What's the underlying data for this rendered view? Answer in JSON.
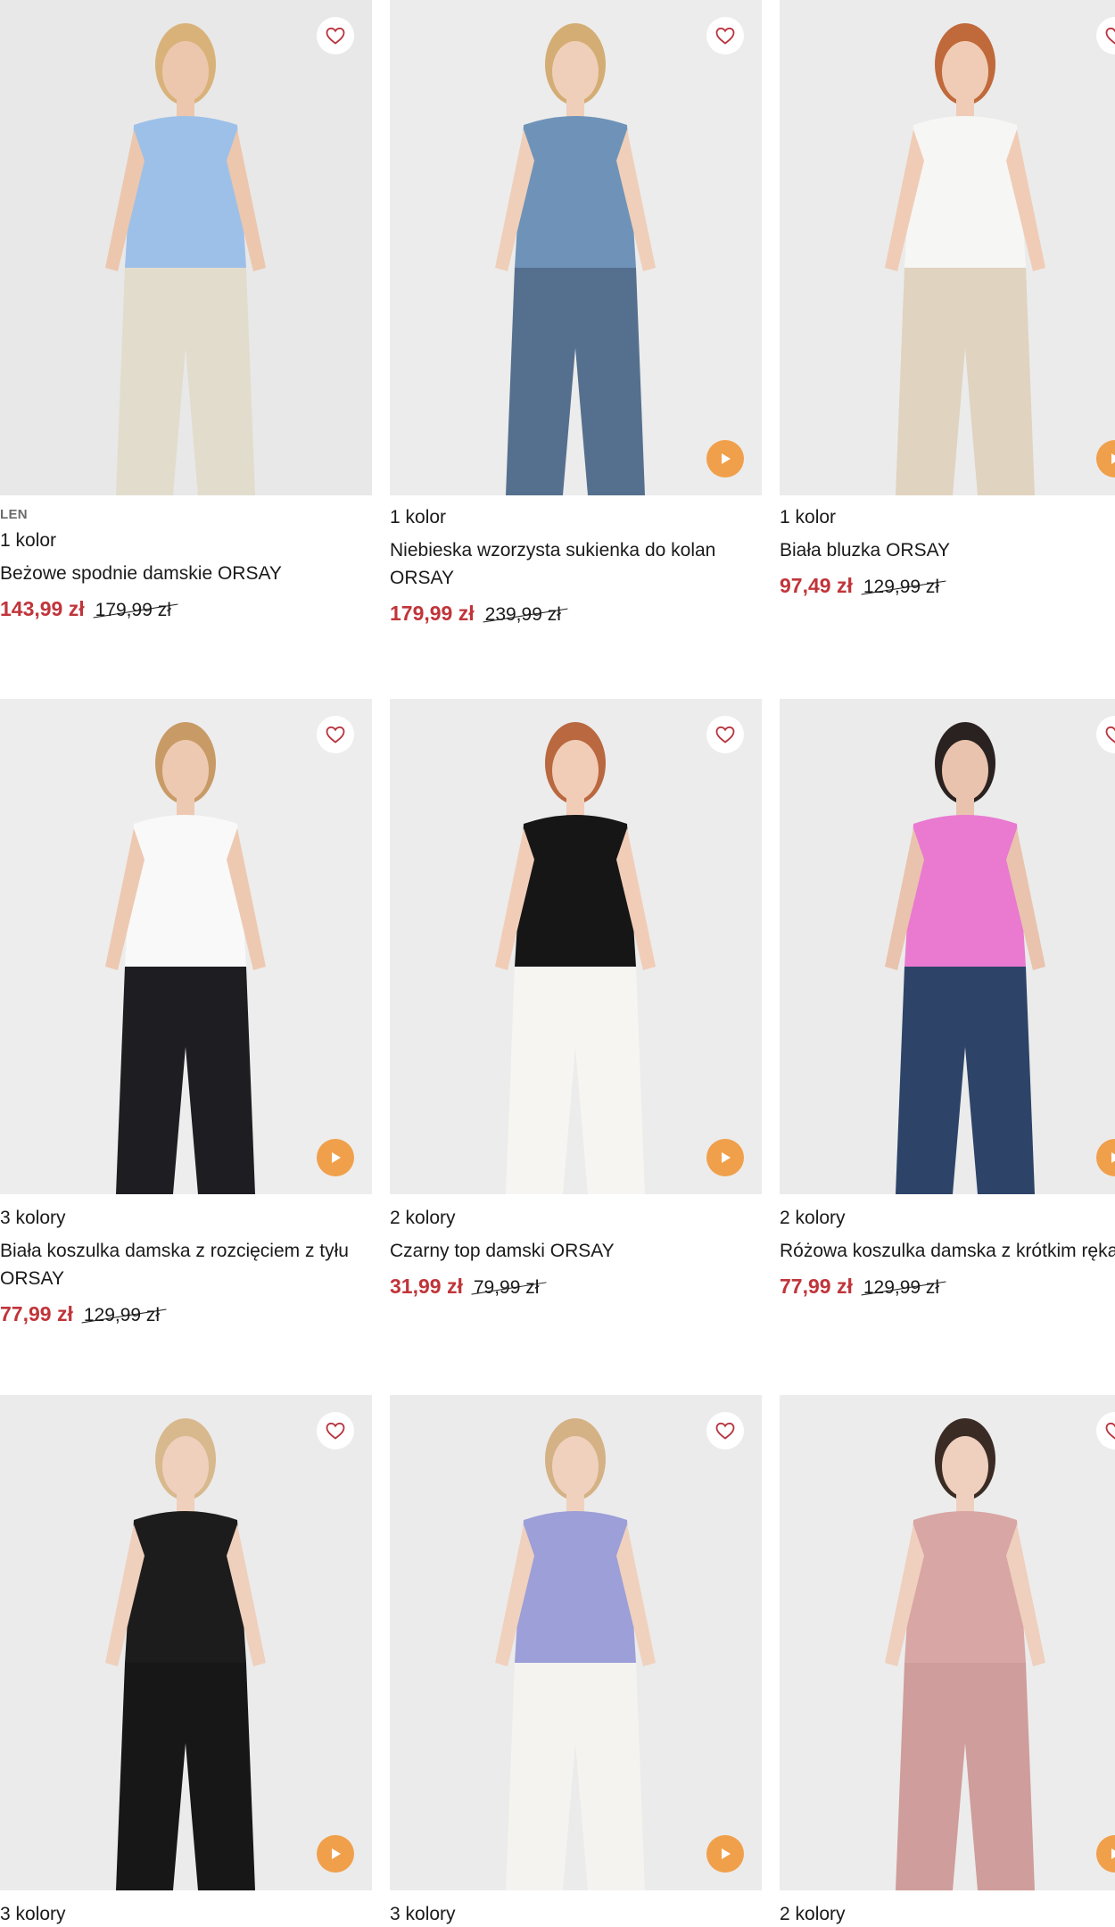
{
  "products": [
    {
      "tag": "LEN",
      "colors": "1 kolor",
      "name": "Beżowe spodnie damskie ORSAY",
      "price": "143,99 zł",
      "old_price": "179,99 zł",
      "has_video": false,
      "bg": "#e8e8e8",
      "top": "#9dc0e8",
      "bottom": "#e2dccd",
      "hair": "#d9b27a",
      "skin": "#ecc7ae"
    },
    {
      "tag": "",
      "colors": "1 kolor",
      "name": "Niebieska wzorzysta sukienka do kolan ORSAY",
      "price": "179,99 zł",
      "old_price": "239,99 zł",
      "has_video": true,
      "bg": "#ececec",
      "top": "#6f93b8",
      "bottom": "#55708e",
      "hair": "#d3ad74",
      "skin": "#efcfb9"
    },
    {
      "tag": "",
      "colors": "1 kolor",
      "name": "Biała bluzka ORSAY",
      "price": "97,49 zł",
      "old_price": "129,99 zł",
      "has_video": true,
      "bg": "#ebebeb",
      "top": "#f6f6f4",
      "bottom": "#e0d3c0",
      "hair": "#c0693a",
      "skin": "#f0ccb6"
    },
    {
      "tag": "",
      "colors": "3 kolory",
      "name": "Biała koszulka damska z rozcięciem z tyłu ORSAY",
      "price": "77,99 zł",
      "old_price": "129,99 zł",
      "has_video": true,
      "bg": "#ededed",
      "top": "#f9f9f9",
      "bottom": "#1e1e22",
      "hair": "#c89b66",
      "skin": "#eec9b2"
    },
    {
      "tag": "",
      "colors": "2 kolory",
      "name": "Czarny top damski ORSAY",
      "price": "31,99 zł",
      "old_price": "79,99 zł",
      "has_video": true,
      "bg": "#ececec",
      "top": "#161616",
      "bottom": "#f6f5f1",
      "hair": "#b9683f",
      "skin": "#f1cdb8"
    },
    {
      "tag": "",
      "colors": "2 kolory",
      "name": "Różowa koszulka damska z krótkim rękawem ORSAY",
      "price": "77,99 zł",
      "old_price": "129,99 zł",
      "has_video": true,
      "bg": "#ebebeb",
      "top": "#e97ad0",
      "bottom": "#2d4468",
      "hair": "#2a2220",
      "skin": "#e9c3ad"
    },
    {
      "tag": "",
      "colors": "3 kolory",
      "name": "",
      "price": "",
      "old_price": "",
      "has_video": true,
      "bg": "#ebebeb",
      "top": "#1c1c1c",
      "bottom": "#171717",
      "hair": "#d8b98e",
      "skin": "#efd0bd"
    },
    {
      "tag": "",
      "colors": "3 kolory",
      "name": "",
      "price": "",
      "old_price": "",
      "has_video": true,
      "bg": "#ebebeb",
      "top": "#9c9fd8",
      "bottom": "#f4f3ef",
      "hair": "#d4b285",
      "skin": "#f0d1be"
    },
    {
      "tag": "",
      "colors": "2 kolory",
      "name": "",
      "price": "",
      "old_price": "",
      "has_video": true,
      "bg": "#ececec",
      "top": "#d8a6a4",
      "bottom": "#cf9d9b",
      "hair": "#3a2c24",
      "skin": "#efcfbd"
    }
  ],
  "icons": {
    "favorite": "heart-outline-icon",
    "video": "play-icon"
  },
  "colors": {
    "accent": "#f0a04b",
    "sale_price": "#c0353a",
    "text": "#1a1a1a"
  }
}
